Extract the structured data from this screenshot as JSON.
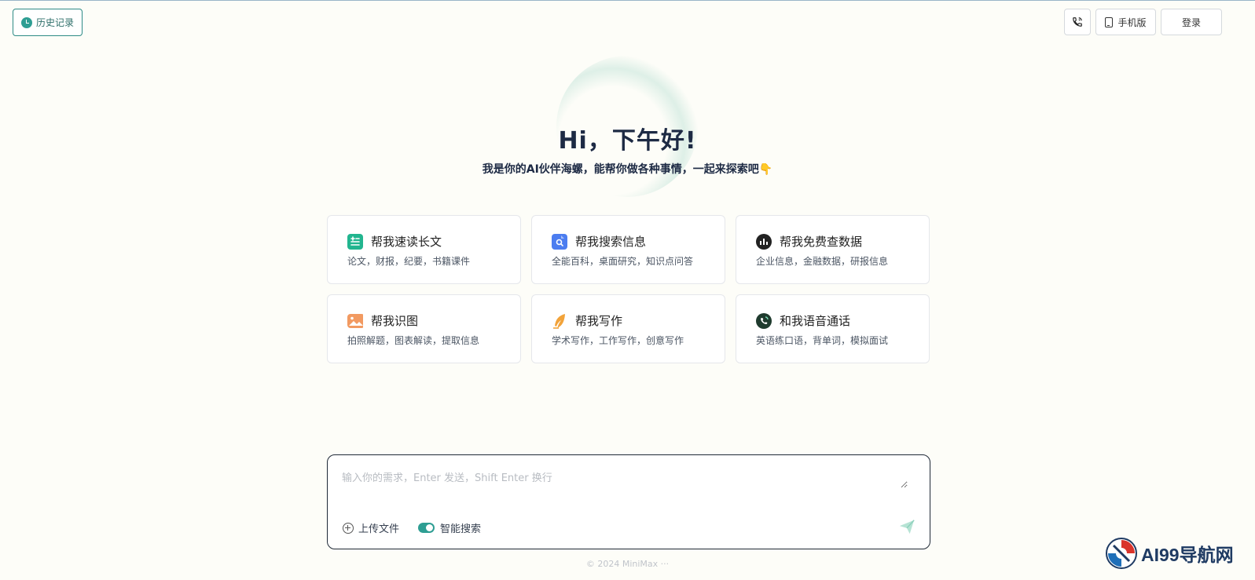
{
  "header": {
    "history_label": "历史记录",
    "mobile_label": "手机版",
    "login_label": "登录"
  },
  "hero": {
    "greeting": "Hi，下午好!",
    "subtitle": "我是你的AI伙伴海螺，能帮你做各种事情，一起来探索吧👇"
  },
  "cards": [
    {
      "title": "帮我速读长文",
      "desc": "论文，财报，纪要，书籍课件",
      "icon": "document-lines-icon",
      "color": "#22b58f"
    },
    {
      "title": "帮我搜索信息",
      "desc": "全能百科，桌面研究，知识点问答",
      "icon": "search-doc-icon",
      "color": "#4c7df0"
    },
    {
      "title": "帮我免费查数据",
      "desc": "企业信息，金融数据，研报信息",
      "icon": "chart-search-icon",
      "color": "#222222"
    },
    {
      "title": "帮我识图",
      "desc": "拍照解题，图表解读，提取信息",
      "icon": "image-icon",
      "color": "#f29a61"
    },
    {
      "title": "帮我写作",
      "desc": "学术写作，工作写作，创意写作",
      "icon": "feather-icon",
      "color": "#f2a33a"
    },
    {
      "title": "和我语音通话",
      "desc": "英语练口语，背单词，模拟面试",
      "icon": "phone-call-icon",
      "color": "#1f3b2e"
    }
  ],
  "composer": {
    "placeholder": "输入你的需求，Enter 发送，Shift Enter 换行",
    "upload_label": "上传文件",
    "smart_search_label": "智能搜索"
  },
  "footer": {
    "copyright": "© 2024 MiniMax ···"
  },
  "watermark": {
    "text": "AI99导航网"
  }
}
